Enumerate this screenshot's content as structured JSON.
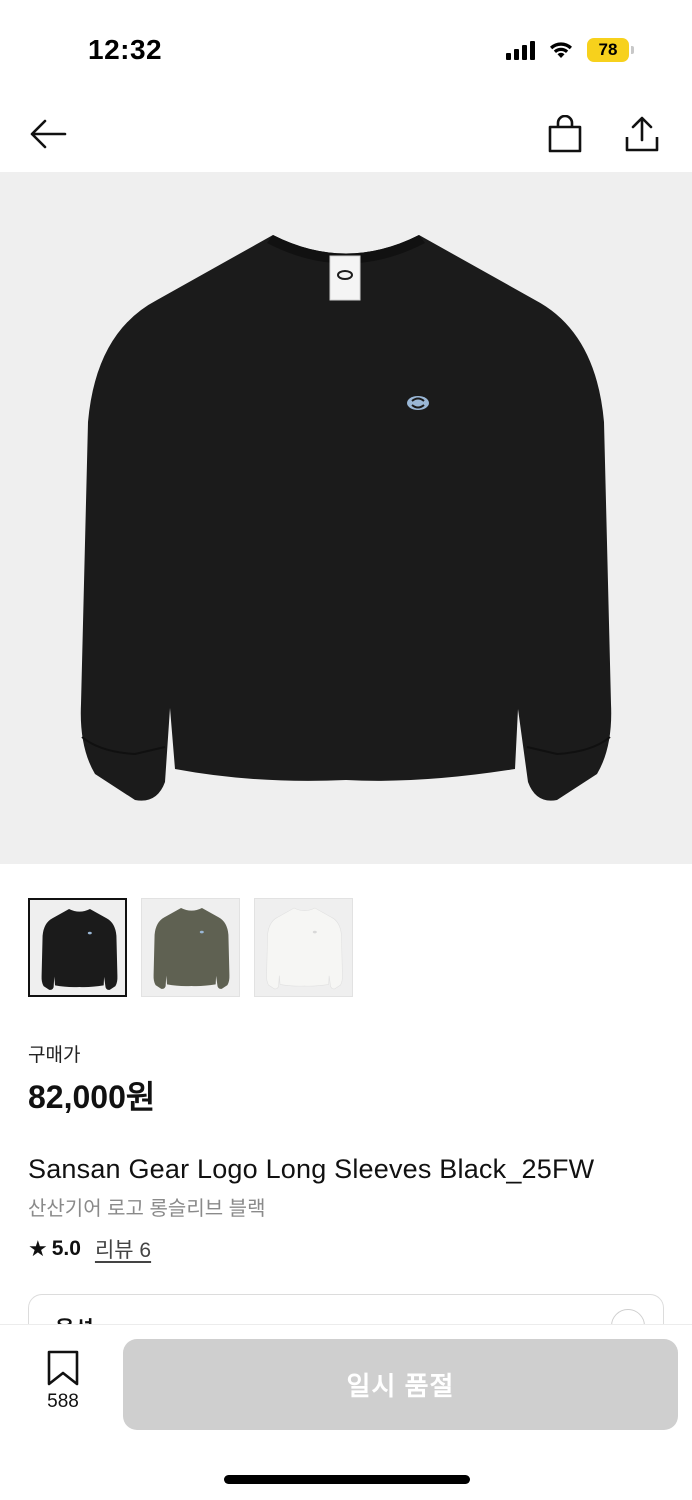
{
  "status_bar": {
    "time": "12:32",
    "battery": "78",
    "battery_color": "#F7D11C"
  },
  "nav": {
    "back_icon": "arrow-left-icon",
    "bag_icon": "shopping-bag-icon",
    "share_icon": "share-icon"
  },
  "product": {
    "price_label": "구매가",
    "price": "82,000원",
    "name": "Sansan Gear Logo Long Sleeves Black_25FW",
    "name_ko": "산산기어 로고 롱슬리브 블랙",
    "rating": "5.0",
    "review_link": "리뷰 6"
  },
  "thumbnails": [
    {
      "color_name": "black",
      "shirt_color": "#1b1b1b",
      "selected": true
    },
    {
      "color_name": "olive",
      "shirt_color": "#5f6152",
      "selected": false
    },
    {
      "color_name": "white",
      "shirt_color": "#f6f6f4",
      "selected": false
    }
  ],
  "option": {
    "label": "옵션"
  },
  "bottom": {
    "bookmark_count": "588",
    "button_label": "일시 품절"
  }
}
